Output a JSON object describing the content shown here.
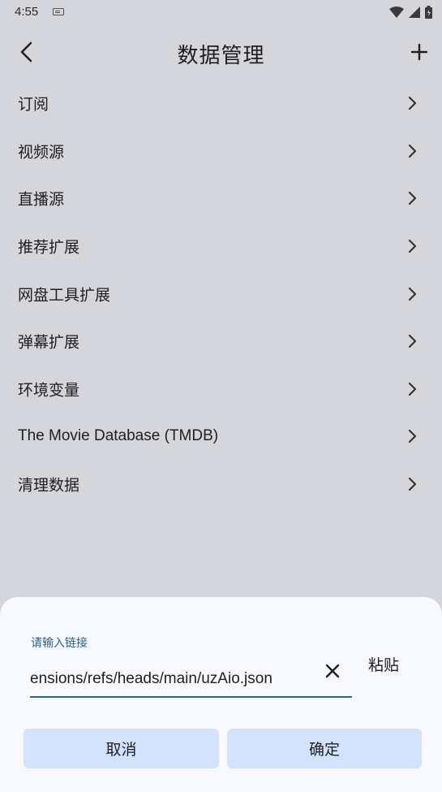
{
  "status_bar": {
    "time": "4:55",
    "icons": [
      "keyboard-icon",
      "wifi-icon",
      "signal-icon",
      "battery-icon"
    ]
  },
  "app_bar": {
    "title": "数据管理",
    "back_icon": "chevron-left-icon",
    "add_icon": "plus-icon"
  },
  "list": {
    "items": [
      {
        "label": "订阅"
      },
      {
        "label": "视频源"
      },
      {
        "label": "直播源"
      },
      {
        "label": "推荐扩展"
      },
      {
        "label": "网盘工具扩展"
      },
      {
        "label": "弹幕扩展"
      },
      {
        "label": "环境变量"
      },
      {
        "label": "The Movie Database (TMDB)"
      },
      {
        "label": "清理数据"
      }
    ]
  },
  "sheet": {
    "field_label": "请输入链接",
    "field_value": "ensions/refs/heads/main/uzAio.json",
    "clear_icon": "close-icon",
    "paste_label": "粘贴",
    "cancel_label": "取消",
    "confirm_label": "确定"
  },
  "colors": {
    "background": "#d5d6db",
    "sheet": "#f8f9fe",
    "accent": "#2b6591",
    "button": "#d3e3fd"
  }
}
